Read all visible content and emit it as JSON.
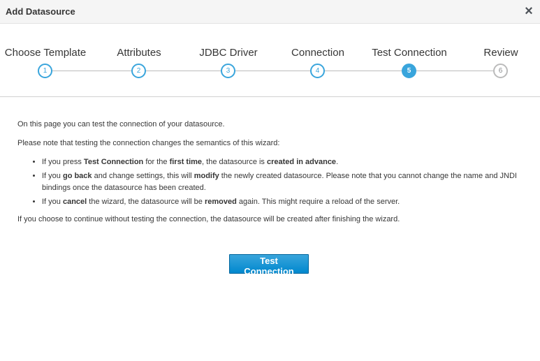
{
  "dialog": {
    "title": "Add Datasource",
    "close_icon": "×"
  },
  "wizard": {
    "steps": [
      {
        "label": "Choose Template",
        "number": "1",
        "state": "completed"
      },
      {
        "label": "Attributes",
        "number": "2",
        "state": "completed"
      },
      {
        "label": "JDBC Driver",
        "number": "3",
        "state": "completed"
      },
      {
        "label": "Connection",
        "number": "4",
        "state": "completed"
      },
      {
        "label": "Test Connection",
        "number": "5",
        "state": "active"
      },
      {
        "label": "Review",
        "number": "6",
        "state": "future"
      }
    ],
    "colors": {
      "accent": "#39a5dc",
      "inactive": "#bbbbbb"
    }
  },
  "content": {
    "intro": "On this page you can test the connection of your datasource.",
    "note": "Please note that testing the connection changes the semantics of this wizard:",
    "bullets": [
      {
        "parts": [
          "If you press ",
          "Test Connection",
          " for the ",
          "first time",
          ", the datasource is ",
          "created in advance",
          "."
        ]
      },
      {
        "parts": [
          "If you ",
          "go back",
          " and change settings, this will ",
          "modify",
          " the newly created datasource. Please note that you cannot change the name and JNDI bindings once the datasource has been created."
        ]
      },
      {
        "parts": [
          "If you ",
          "cancel",
          " the wizard, the datasource will be ",
          "removed",
          " again. This might require a reload of the server."
        ]
      }
    ],
    "footer": "If you choose to continue without testing the connection, the datasource will be created after finishing the wizard."
  },
  "actions": {
    "test_connection_label": "Test Connection"
  }
}
